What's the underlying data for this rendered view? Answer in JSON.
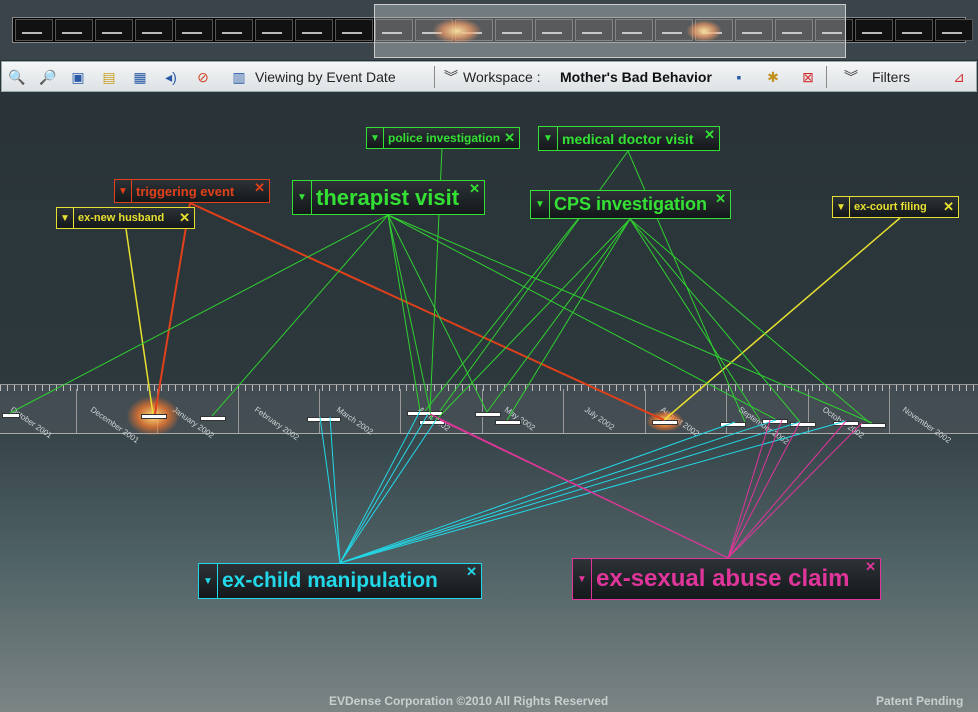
{
  "toolbar": {
    "viewing_label": "Viewing by Event Date",
    "workspace_label": "Workspace :",
    "workspace_name": "Mother's Bad Behavior",
    "filters_label": "Filters"
  },
  "timeline": {
    "months": [
      "October 2001",
      "December 2001",
      "January 2002",
      "February 2002",
      "March 2002",
      "April 2002",
      "May 2002",
      "July 2002",
      "August 2002",
      "September 2002",
      "October 2002",
      "November 2002"
    ]
  },
  "tags": {
    "police_investigation": "police investigation",
    "medical_doctor_visit": "medical doctor visit",
    "triggering_event": "triggering event",
    "therapist_visit": "therapist visit",
    "cps_investigation": "CPS investigation",
    "ex_new_husband": "ex-new husband",
    "ex_court_filing": "ex-court filing",
    "ex_child_manipulation": "ex-child manipulation",
    "ex_sexual_abuse_claim": "ex-sexual abuse claim"
  },
  "colors": {
    "green": "#33e033",
    "red": "#e0401a",
    "yellow": "#e8e030",
    "cyan": "#22d8e8",
    "magenta": "#e0359a"
  },
  "icons": [
    "zoom-in-icon",
    "zoom-out-icon",
    "camera-icon",
    "notes-icon",
    "report-icon",
    "audio-icon",
    "clear-icon",
    "calendar-icon",
    "chevron-down-icon",
    "save-icon",
    "new-workspace-icon",
    "delete-workspace-icon",
    "filter-icon"
  ],
  "footer": {
    "copyright": "EVDense Corporation ©2010 All Rights Reserved",
    "patent": "Patent Pending"
  }
}
